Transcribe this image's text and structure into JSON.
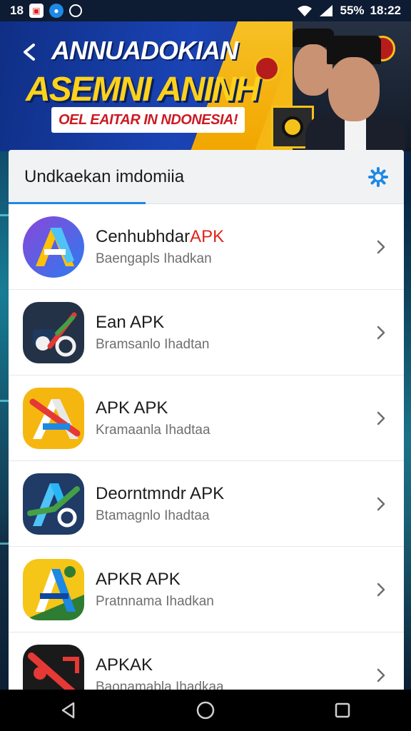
{
  "status_bar": {
    "time_left": "18",
    "battery": "55%",
    "time_right": "18:22"
  },
  "banner": {
    "title_line1": "ANNUADOKIAN",
    "title_line2": "ASEMNI ANINH",
    "subtitle": "OEL EAITAR IN NDONESIA!"
  },
  "card": {
    "title": "Undkaekan imdomiia"
  },
  "apps": [
    {
      "title": "Cenhubhdar",
      "title_accent": "APK",
      "subtitle": "Baengapls Ihadkan",
      "icon": "blue-purple-a-icon"
    },
    {
      "title": "Ean APK",
      "subtitle": "Bramsanlo Ihadtan",
      "icon": "dark-tractor-icon"
    },
    {
      "title": "APK APK",
      "subtitle": "Kramaanla Ihadtaa",
      "icon": "yellow-a-icon"
    },
    {
      "title": "Deorntmndr APK",
      "subtitle": "Btamagnlo Ihadtaa",
      "icon": "navy-a-icon"
    },
    {
      "title": "APKR APK",
      "subtitle": "Pratnnama Ihadkan",
      "icon": "yellow-green-a-icon"
    },
    {
      "title": "APKAK",
      "subtitle": "Baonamabla Ihadkaa",
      "icon": "red-black-icon"
    }
  ],
  "colors": {
    "accent": "#1e88e5",
    "banner_blue": "#1a43b5",
    "banner_yellow": "#f6b612",
    "chevron": "#6d6d6d"
  }
}
